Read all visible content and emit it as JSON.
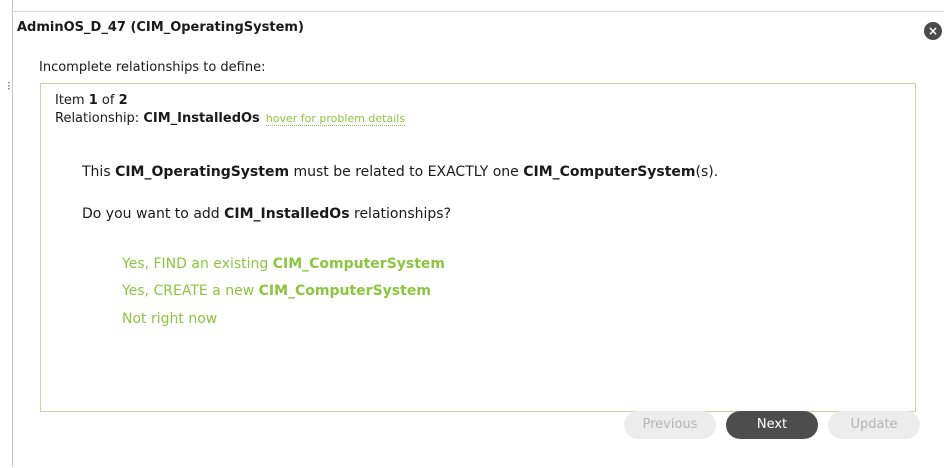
{
  "dialog": {
    "title": "AdminOS_D_47 (CIM_OperatingSystem)",
    "close_glyph": "×",
    "section_label": "Incomplete relationships to define:"
  },
  "item": {
    "prefix": "Item ",
    "current": "1",
    "of": " of ",
    "total": "2"
  },
  "relationship": {
    "label": "Relationship: ",
    "name": "CIM_InstalledOs",
    "hover_link": "hover for problem details"
  },
  "description": {
    "part1": "This ",
    "source_class": "CIM_OperatingSystem",
    "part2": " must be related to EXACTLY one ",
    "target_class": "CIM_ComputerSystem",
    "part3": "(s)."
  },
  "question": {
    "part1": "Do you want to add ",
    "relationship": "CIM_InstalledOs",
    "part2": " relationships?"
  },
  "options": {
    "find_prefix": "Yes, FIND an existing ",
    "find_class": "CIM_ComputerSystem",
    "create_prefix": "Yes, CREATE a new ",
    "create_class": "CIM_ComputerSystem",
    "skip": "Not right now"
  },
  "buttons": {
    "previous": "Previous",
    "next": "Next",
    "update": "Update"
  },
  "colors": {
    "accent_green": "#8cc63f",
    "panel_border": "#c7d6a6",
    "next_button": "#4d4d4d",
    "disabled_button": "#ececec"
  },
  "icons": {
    "close": "close-icon"
  },
  "left_mark": "⁝"
}
